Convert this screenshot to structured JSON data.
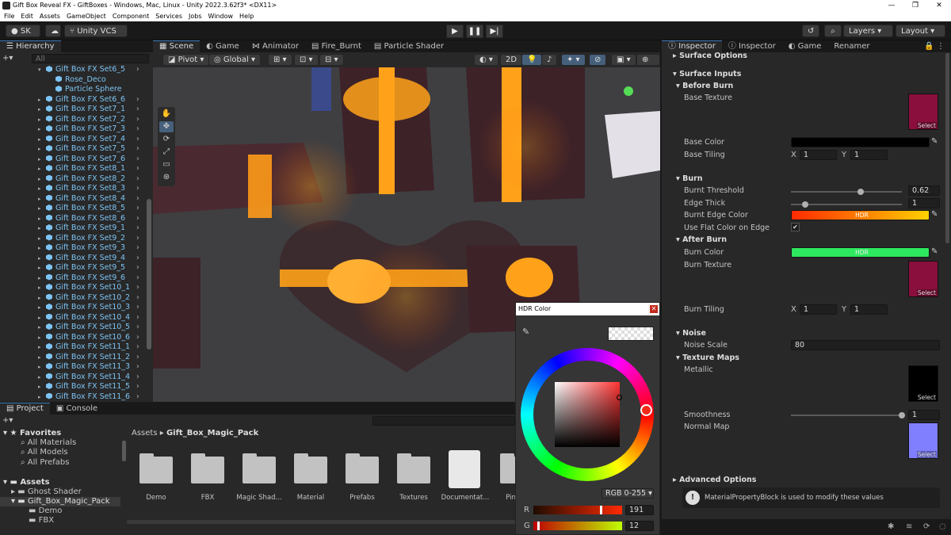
{
  "window": {
    "title": "Gift Box Reveal FX - GiftBoxes - Windows, Mac, Linux - Unity 2022.3.62f3* <DX11>",
    "controls": [
      "—",
      "❐",
      "✕"
    ]
  },
  "menu": [
    "File",
    "Edit",
    "Assets",
    "GameObject",
    "Component",
    "Services",
    "Jobs",
    "Window",
    "Help"
  ],
  "toolbar": {
    "account": "SK",
    "vcs": "Unity VCS",
    "layers": "Layers",
    "layout": "Layout"
  },
  "hierarchy": {
    "title": "Hierarchy",
    "search_placeholder": "All",
    "items": [
      {
        "label": "Gift Box FX Set6_5",
        "indent": 1,
        "expanded": true
      },
      {
        "label": "Rose_Deco",
        "indent": 2
      },
      {
        "label": "Particle Sphere",
        "indent": 2
      },
      {
        "label": "Gift Box FX Set6_6",
        "indent": 1
      },
      {
        "label": "Gift Box FX Set7_1",
        "indent": 1
      },
      {
        "label": "Gift Box FX Set7_2",
        "indent": 1
      },
      {
        "label": "Gift Box FX Set7_3",
        "indent": 1
      },
      {
        "label": "Gift Box FX Set7_4",
        "indent": 1
      },
      {
        "label": "Gift Box FX Set7_5",
        "indent": 1
      },
      {
        "label": "Gift Box FX Set7_6",
        "indent": 1
      },
      {
        "label": "Gift Box FX Set8_1",
        "indent": 1
      },
      {
        "label": "Gift Box FX Set8_2",
        "indent": 1
      },
      {
        "label": "Gift Box FX Set8_3",
        "indent": 1
      },
      {
        "label": "Gift Box FX Set8_4",
        "indent": 1
      },
      {
        "label": "Gift Box FX Set8_5",
        "indent": 1
      },
      {
        "label": "Gift Box FX Set8_6",
        "indent": 1
      },
      {
        "label": "Gift Box FX Set9_1",
        "indent": 1
      },
      {
        "label": "Gift Box FX Set9_2",
        "indent": 1
      },
      {
        "label": "Gift Box FX Set9_3",
        "indent": 1
      },
      {
        "label": "Gift Box FX Set9_4",
        "indent": 1
      },
      {
        "label": "Gift Box FX Set9_5",
        "indent": 1
      },
      {
        "label": "Gift Box FX Set9_6",
        "indent": 1
      },
      {
        "label": "Gift Box FX Set10_1",
        "indent": 1
      },
      {
        "label": "Gift Box FX Set10_2",
        "indent": 1
      },
      {
        "label": "Gift Box FX Set10_3",
        "indent": 1
      },
      {
        "label": "Gift Box FX Set10_4",
        "indent": 1
      },
      {
        "label": "Gift Box FX Set10_5",
        "indent": 1
      },
      {
        "label": "Gift Box FX Set10_6",
        "indent": 1
      },
      {
        "label": "Gift Box FX Set11_1",
        "indent": 1
      },
      {
        "label": "Gift Box FX Set11_2",
        "indent": 1
      },
      {
        "label": "Gift Box FX Set11_3",
        "indent": 1
      },
      {
        "label": "Gift Box FX Set11_4",
        "indent": 1
      },
      {
        "label": "Gift Box FX Set11_5",
        "indent": 1
      },
      {
        "label": "Gift Box FX Set11_6",
        "indent": 1
      }
    ]
  },
  "scene": {
    "tabs": [
      "Scene",
      "Game",
      "Animator",
      "Fire_Burnt",
      "Particle Shader"
    ],
    "pivot": "Pivot",
    "global": "Global",
    "mode2d": "2D"
  },
  "project": {
    "tabs": [
      "Project",
      "Console"
    ],
    "favorites_title": "Favorites",
    "favorites": [
      "All Materials",
      "All Models",
      "All Prefabs"
    ],
    "assets_title": "Assets",
    "tree": [
      "Ghost Shader",
      "Gift_Box_Magic_Pack",
      "Demo",
      "FBX"
    ],
    "breadcrumb": [
      "Assets",
      "Gift_Box_Magic_Pack"
    ],
    "folders": [
      "Demo",
      "FBX",
      "Magic Shad...",
      "Material",
      "Prefabs",
      "Textures",
      "Documentat...",
      "Pink M"
    ]
  },
  "inspector": {
    "tabs": [
      "Inspector",
      "Inspector",
      "Game",
      "Renamer"
    ],
    "surface_options": "Surface Options",
    "surface_inputs": "Surface Inputs",
    "before_burn": "Before Burn",
    "base_texture": "Base Texture",
    "select": "Select",
    "base_color": "Base Color",
    "base_tiling": "Base Tiling",
    "x": "X",
    "y": "Y",
    "base_tiling_x": "1",
    "base_tiling_y": "1",
    "burn": "Burn",
    "burnt_threshold": "Burnt Threshold",
    "burnt_threshold_value": "0.62",
    "edge_thick": "Edge Thick",
    "edge_thick_value": "1",
    "burnt_edge_color": "Burnt Edge Color",
    "hdr": "HDR",
    "use_flat": "Use Flat Color on Edge",
    "check": "✔",
    "after_burn": "After Burn",
    "burn_color": "Burn Color",
    "burn_texture": "Burn Texture",
    "burn_tiling": "Burn Tiling",
    "burn_tiling_x": "1",
    "burn_tiling_y": "1",
    "noise": "Noise",
    "noise_scale": "Noise Scale",
    "noise_scale_value": "80",
    "texture_maps": "Texture Maps",
    "metallic": "Metallic",
    "smoothness": "Smoothness",
    "smoothness_value": "1",
    "normal_map": "Normal Map",
    "advanced": "Advanced Options",
    "info": "MaterialPropertyBlock is used to modify these values"
  },
  "colorpicker": {
    "title": "HDR Color",
    "mode": "RGB 0-255",
    "r_label": "R",
    "r_value": "191",
    "g_label": "G",
    "g_value": "12"
  },
  "colors": {
    "accent": "#3a79bb",
    "hier_text": "#7dc4f4",
    "burnt_edge_from": "#ff2a00",
    "burnt_edge_to": "#ffd000",
    "burn_color": "#2ee860",
    "texture": "#8a0f3c",
    "normal": "#8080ff"
  }
}
